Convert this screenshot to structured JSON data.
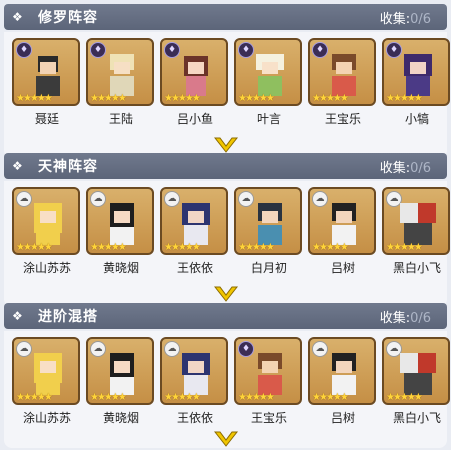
{
  "sections": [
    {
      "title": "修罗阵容",
      "collect_label": "收集:",
      "collect_value": "0/6",
      "heroes": [
        {
          "name": "聂廷",
          "badge": "purple"
        },
        {
          "name": "王陆",
          "badge": "purple"
        },
        {
          "name": "吕小鱼",
          "badge": "purple"
        },
        {
          "name": "叶言",
          "badge": "purple"
        },
        {
          "name": "王宝乐",
          "badge": "purple"
        },
        {
          "name": "小犒",
          "badge": "purple"
        }
      ]
    },
    {
      "title": "天神阵容",
      "collect_label": "收集:",
      "collect_value": "0/6",
      "heroes": [
        {
          "name": "涂山苏苏",
          "badge": "white"
        },
        {
          "name": "黄晓烟",
          "badge": "white"
        },
        {
          "name": "王依依",
          "badge": "white"
        },
        {
          "name": "白月初",
          "badge": "white"
        },
        {
          "name": "吕树",
          "badge": "white"
        },
        {
          "name": "黑白小飞",
          "badge": "white"
        }
      ]
    },
    {
      "title": "进阶混搭",
      "collect_label": "收集:",
      "collect_value": "0/6",
      "heroes": [
        {
          "name": "涂山苏苏",
          "badge": "white"
        },
        {
          "name": "黄晓烟",
          "badge": "white"
        },
        {
          "name": "王依依",
          "badge": "white"
        },
        {
          "name": "王宝乐",
          "badge": "purple"
        },
        {
          "name": "吕树",
          "badge": "white"
        },
        {
          "name": "黑白小飞",
          "badge": "white"
        }
      ]
    }
  ],
  "colors": {
    "header": "#5c6579",
    "card_bg": "#d2a45c",
    "star": "#ffd43a",
    "chevron": "#f0c500"
  },
  "icons": {
    "header": "diamond-arrow-icon",
    "expand": "chevron-down-icon",
    "star": "star-icon"
  }
}
